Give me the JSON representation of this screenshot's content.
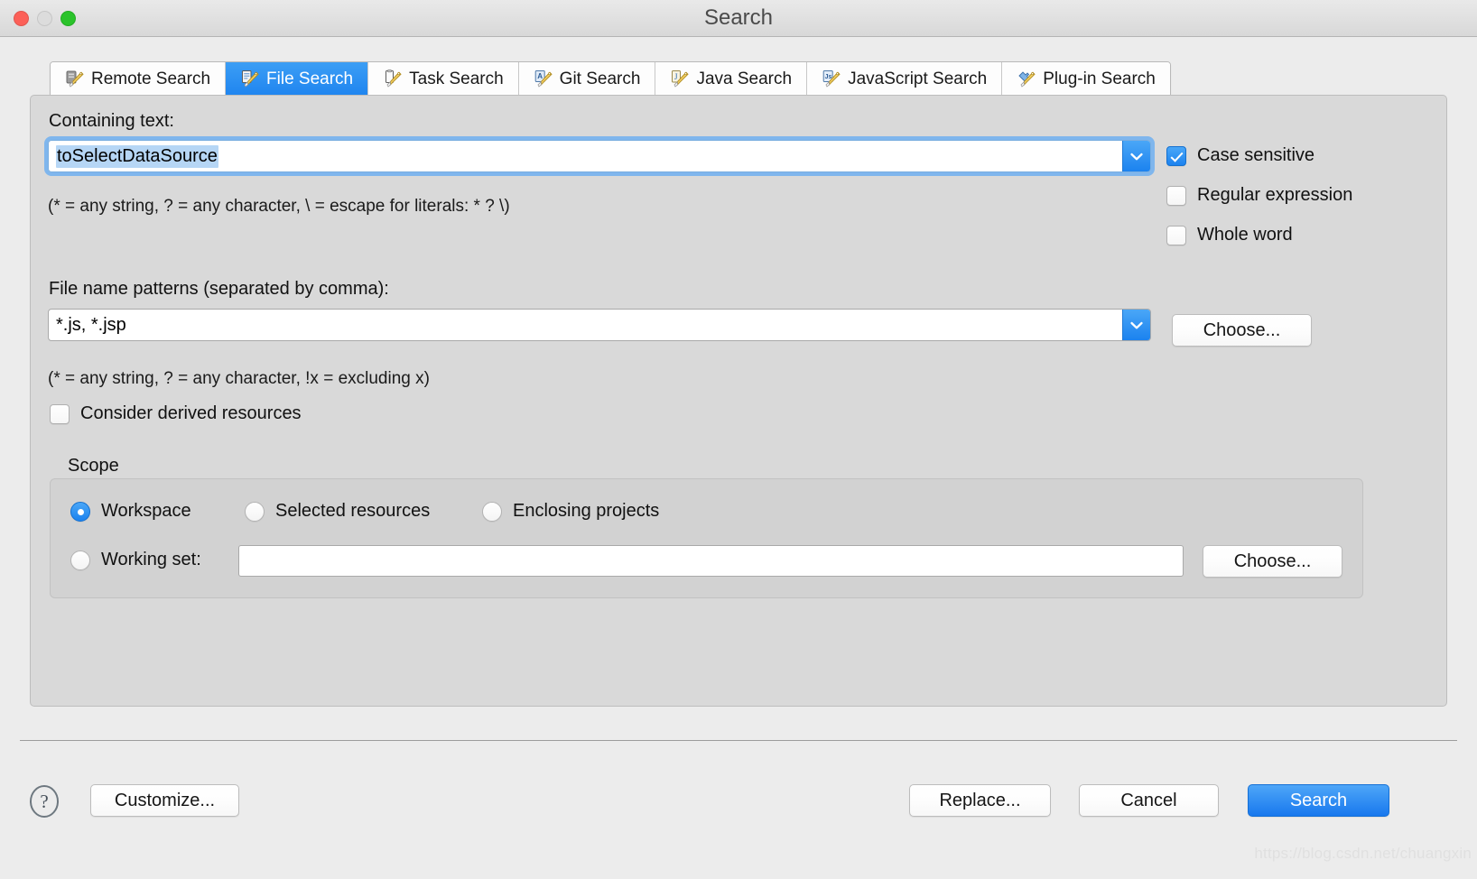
{
  "window": {
    "title": "Search",
    "traffic_lights": [
      "close-button",
      "minimize-button",
      "maximize-button"
    ]
  },
  "tabs": [
    {
      "label": "Remote Search",
      "icon": "remote-search-icon",
      "active": false
    },
    {
      "label": "File Search",
      "icon": "file-search-icon",
      "active": true
    },
    {
      "label": "Task Search",
      "icon": "task-search-icon",
      "active": false
    },
    {
      "label": "Git Search",
      "icon": "git-search-icon",
      "active": false
    },
    {
      "label": "Java Search",
      "icon": "java-search-icon",
      "active": false
    },
    {
      "label": "JavaScript Search",
      "icon": "javascript-search-icon",
      "active": false
    },
    {
      "label": "Plug-in Search",
      "icon": "plugin-search-icon",
      "active": false
    }
  ],
  "containing_text": {
    "label": "Containing text:",
    "value": "toSelectDataSource",
    "selected": true,
    "hint": "(* = any string, ? = any character, \\ = escape for literals: * ? \\)"
  },
  "options": {
    "case_sensitive": {
      "label": "Case sensitive",
      "checked": true
    },
    "regular_expression": {
      "label": "Regular expression",
      "checked": false
    },
    "whole_word": {
      "label": "Whole word",
      "checked": false
    }
  },
  "file_patterns": {
    "label": "File name patterns (separated by comma):",
    "value": "*.js, *.jsp",
    "hint": "(* = any string, ? = any character, !x = excluding x)",
    "choose_label": "Choose..."
  },
  "derived": {
    "label": "Consider derived resources",
    "checked": false
  },
  "scope": {
    "title": "Scope",
    "radios": [
      {
        "label": "Workspace",
        "checked": true
      },
      {
        "label": "Selected resources",
        "checked": false
      },
      {
        "label": "Enclosing projects",
        "checked": false
      }
    ],
    "working_set": {
      "label": "Working set:",
      "checked": false,
      "value": "",
      "choose_label": "Choose..."
    }
  },
  "footer": {
    "help_icon": "help-icon",
    "customize_label": "Customize...",
    "replace_label": "Replace...",
    "cancel_label": "Cancel",
    "search_label": "Search"
  },
  "watermark": "https://blog.csdn.net/chuangxin",
  "colors": {
    "accent": "#1878ee",
    "selection": "#b6d6f5",
    "window_bg": "#ececec",
    "panel_bg": "#d9d9d9",
    "group_bg": "#d2d2d2"
  }
}
